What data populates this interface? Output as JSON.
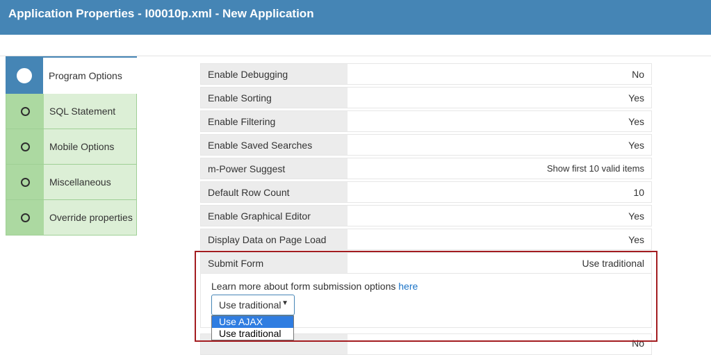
{
  "window": {
    "title": "Application Properties - I00010p.xml - New Application"
  },
  "sidebar": {
    "items": [
      {
        "label": "Program Options",
        "active": true
      },
      {
        "label": "SQL Statement",
        "active": false
      },
      {
        "label": "Mobile Options",
        "active": false
      },
      {
        "label": "Miscellaneous",
        "active": false
      },
      {
        "label": "Override properties",
        "active": false
      }
    ]
  },
  "properties": [
    {
      "key": "Enable Debugging",
      "value": "No"
    },
    {
      "key": "Enable Sorting",
      "value": "Yes"
    },
    {
      "key": "Enable Filtering",
      "value": "Yes"
    },
    {
      "key": "Enable Saved Searches",
      "value": "Yes"
    },
    {
      "key": "m-Power Suggest",
      "value": "Show first 10 valid items"
    },
    {
      "key": "Default Row Count",
      "value": "10"
    },
    {
      "key": "Enable Graphical Editor",
      "value": "Yes"
    },
    {
      "key": "Display Data on Page Load",
      "value": "Yes"
    }
  ],
  "submit_form": {
    "key": "Submit Form",
    "value": "Use traditional",
    "learn_text": "Learn more about form submission options",
    "learn_link": "here",
    "select_value": "Use traditional",
    "options": [
      "Use AJAX",
      "Use traditional"
    ],
    "highlighted_option": "Use AJAX"
  },
  "cut_row": {
    "value": "No"
  },
  "colors": {
    "title_bar": "#4585b5",
    "highlight_border": "#a31c20",
    "step_fill": "#dcefd6"
  }
}
